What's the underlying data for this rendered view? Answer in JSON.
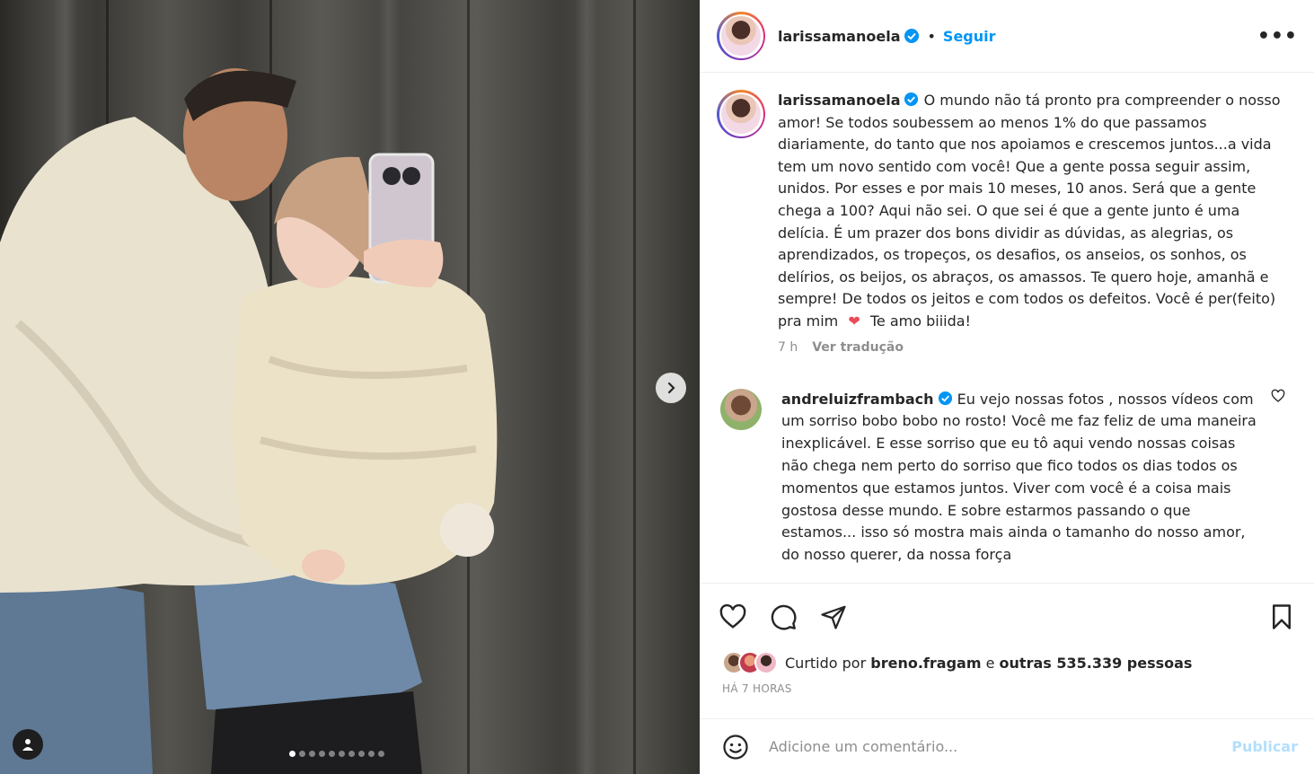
{
  "header": {
    "username": "larissamanoela",
    "separator": "•",
    "follow_label": "Seguir",
    "more_label": "•••"
  },
  "caption": {
    "username": "larissamanoela",
    "text": "O mundo não tá pronto pra compreender o nosso amor! Se todos soubessem ao menos 1% do que passamos diariamente, do tanto que nos apoiamos e crescemos juntos...a vida tem um novo sentido com você! Que a gente possa seguir assim, unidos. Por esses e por mais 10 meses, 10 anos. Será que a gente chega a 100? Aqui não sei. O que sei é que a gente junto é uma delícia. É um prazer dos bons dividir as dúvidas, as alegrias, os aprendizados, os tropeços, os desafios, os anseios, os sonhos, os delírios, os beijos, os abraços, os amassos. Te quero hoje, amanhã e sempre! De todos os jeitos e com todos os defeitos. Você é per(feito) pra mim",
    "text_after_emoji": "Te amo biiida!",
    "age": "7 h",
    "translate_label": "Ver tradução"
  },
  "comment": {
    "username": "andreluizframbach",
    "text": "Eu vejo nossas fotos , nossos vídeos com um sorriso bobo bobo no rosto! Você me faz feliz de uma maneira inexplicável. E esse sorriso que eu tô aqui vendo nossas coisas não chega nem perto do sorriso que fico todos os dias todos os momentos que estamos juntos. Viver com você é a coisa mais gostosa desse mundo. E sobre estarmos passando o que estamos... isso só mostra mais ainda o tamanho do nosso amor, do nosso querer, da nossa força"
  },
  "likes": {
    "prefix": "Curtido por",
    "first_user": "breno.fragam",
    "conjunction": "e",
    "others": "outras 535.339 pessoas"
  },
  "post_time": "HÁ 7 HORAS",
  "comment_input": {
    "placeholder": "Adicione um comentário...",
    "publish_label": "Publicar"
  },
  "carousel": {
    "slide_count": 10,
    "active_index": 0
  },
  "colors": {
    "accent": "#0095f6",
    "publish_disabled": "#b2dffc",
    "heart_red": "#ed4956",
    "verified_blue": "#0095f6"
  },
  "icons": [
    "verified-icon",
    "more-options-icon",
    "chevron-right-icon",
    "user-tag-icon",
    "like-icon",
    "comment-icon",
    "share-icon",
    "save-icon",
    "heart-small-icon",
    "emoji-icon",
    "red-heart-emoji"
  ]
}
